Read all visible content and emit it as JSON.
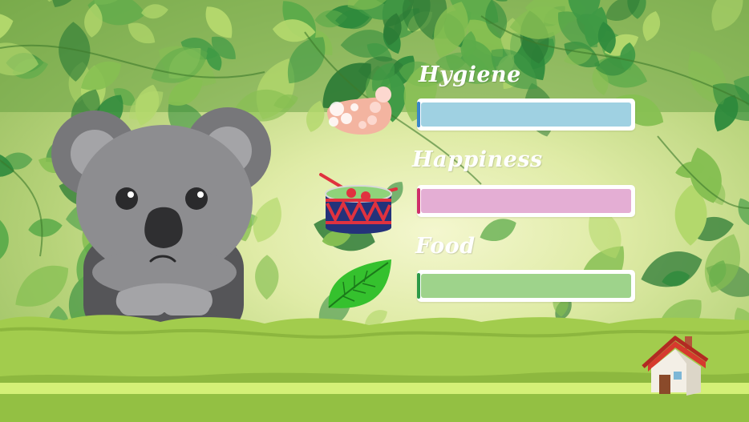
{
  "stats": [
    {
      "key": "hygiene",
      "label": "Hygiene",
      "icon": "bath-foot-icon",
      "fill_color": "#9fd1e2",
      "edge_color": "#3a86c8",
      "level": 1.0
    },
    {
      "key": "happiness",
      "label": "Happiness",
      "icon": "drum-icon",
      "fill_color": "#e4aed4",
      "edge_color": "#cf2f6a",
      "level": 1.0
    },
    {
      "key": "food",
      "label": "Food",
      "icon": "leaf-icon",
      "fill_color": "#9ed38b",
      "edge_color": "#2e9a48",
      "level": 1.0
    }
  ],
  "character": {
    "name_icon": "koala-icon",
    "mood": "sad"
  },
  "home_button": {
    "icon": "house-icon"
  },
  "colors": {
    "foliage_dark": "#2e8a3c",
    "foliage_light": "#b3d86c",
    "ground": "#a2cc4d",
    "ground_stripe": "#d4f077"
  }
}
